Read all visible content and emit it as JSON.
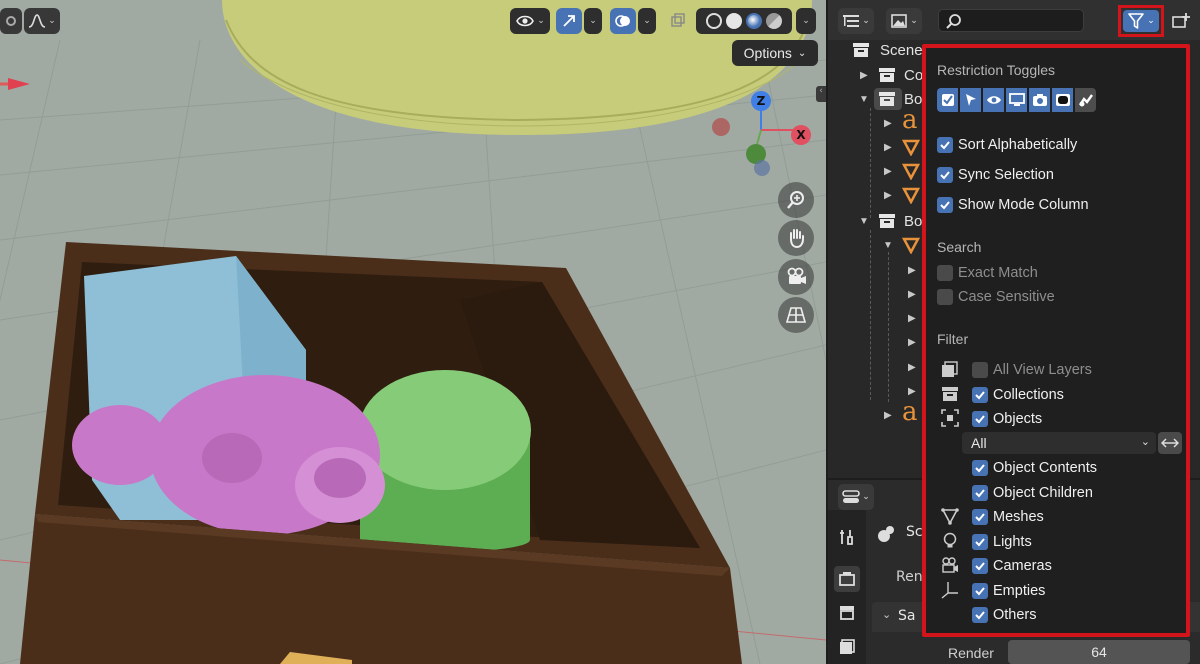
{
  "viewport": {
    "options_label": "Options",
    "gizmo": {
      "z_label": "Z",
      "x_label": "X"
    }
  },
  "outliner": {
    "rows": [
      {
        "label": "Scene"
      },
      {
        "label": "Co"
      },
      {
        "label": "Bo"
      },
      {
        "label": "a"
      },
      {
        "label": "Bo"
      },
      {
        "label": "a"
      }
    ]
  },
  "properties": {
    "row_labels": {
      "scene": "Sc",
      "render": "Ren",
      "sampling": "Sa"
    },
    "render_label": "Render",
    "render_value": "64"
  },
  "filter_popover": {
    "restriction_heading": "Restriction Toggles",
    "restriction_toggles": [
      {
        "icon": "checkbox-icon",
        "on": true
      },
      {
        "icon": "select-cursor-icon",
        "on": true
      },
      {
        "icon": "eye-icon",
        "on": true
      },
      {
        "icon": "monitor-icon",
        "on": true
      },
      {
        "icon": "camera-icon",
        "on": true
      },
      {
        "icon": "holdout-icon",
        "on": true
      },
      {
        "icon": "indirect-only-icon",
        "on": false
      }
    ],
    "sort_alphabetically": "Sort Alphabetically",
    "sync_selection": "Sync Selection",
    "show_mode_column": "Show Mode Column",
    "search_heading": "Search",
    "exact_match": "Exact Match",
    "case_sensitive": "Case Sensitive",
    "filter_heading": "Filter",
    "all_view_layers": "All View Layers",
    "collections": "Collections",
    "objects": "Objects",
    "object_filter_value": "All",
    "object_contents": "Object Contents",
    "object_children": "Object Children",
    "meshes": "Meshes",
    "lights": "Lights",
    "cameras": "Cameras",
    "empties": "Empties",
    "others": "Others"
  },
  "colors": {
    "accent": "#4772b3",
    "highlight_box": "#d3141b",
    "panel_bg": "#1f1f1f",
    "box_color": "#4a2e1a",
    "monkey_color": "#c878c8",
    "cylinder_color": "#74c266",
    "cube_color": "#8fbfd6",
    "dome_color": "#c6cc79"
  }
}
